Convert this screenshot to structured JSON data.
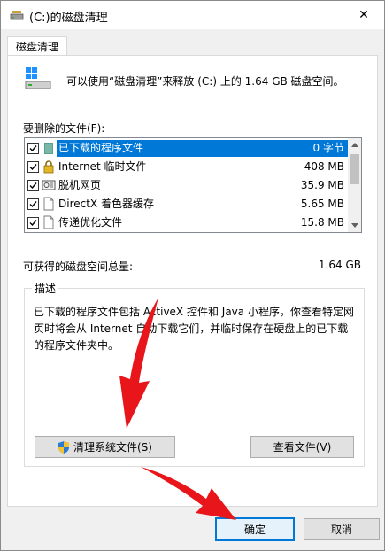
{
  "window": {
    "title": "(C:)的磁盘清理",
    "close_glyph": "✕"
  },
  "tabs": [
    {
      "label": "磁盘清理"
    }
  ],
  "summary": "可以使用“磁盘清理”来释放  (C:) 上的 1.64 GB 磁盘空间。",
  "files_label": "要删除的文件(F):",
  "files": [
    {
      "label": "已下载的程序文件",
      "size": "0 字节",
      "checked": true,
      "selected": true,
      "icon": "folder-green-icon"
    },
    {
      "label": "Internet 临时文件",
      "size": "408 MB",
      "checked": true,
      "selected": false,
      "icon": "lock-icon"
    },
    {
      "label": "脱机网页",
      "size": "35.9 MB",
      "checked": true,
      "selected": false,
      "icon": "offline-pages-icon"
    },
    {
      "label": "DirectX 着色器缓存",
      "size": "5.65 MB",
      "checked": true,
      "selected": false,
      "icon": "document-icon"
    },
    {
      "label": "传递优化文件",
      "size": "15.8 MB",
      "checked": true,
      "selected": false,
      "icon": "document-icon"
    }
  ],
  "space": {
    "label": "可获得的磁盘空间总量:",
    "value": "1.64 GB"
  },
  "description": {
    "title": "描述",
    "text": "已下载的程序文件包括 ActiveX 控件和 Java 小程序，你查看特定网页时将会从 Internet 自动下载它们，并临时保存在硬盘上的已下载的程序文件夹中。"
  },
  "buttons": {
    "clean_system": "清理系统文件(S)",
    "view_files": "查看文件(V)",
    "ok": "确定",
    "cancel": "取消"
  },
  "colors": {
    "selection": "#0078d7",
    "annotation_arrow": "#e8161b"
  }
}
